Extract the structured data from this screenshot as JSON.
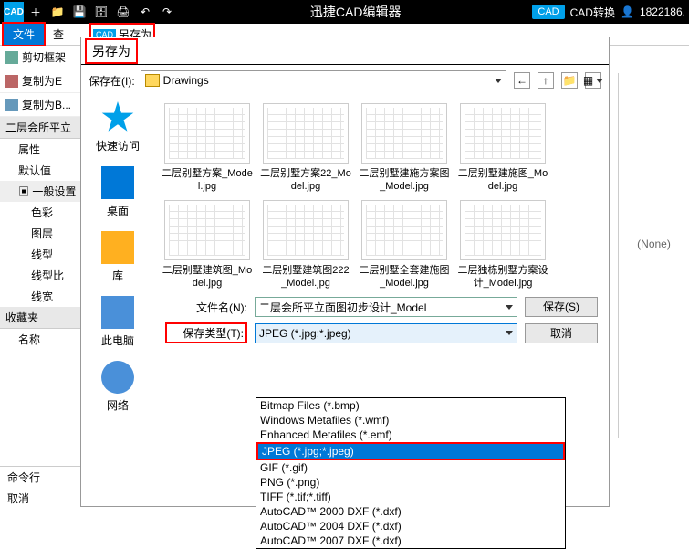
{
  "titlebar": {
    "title": "迅捷CAD编辑器",
    "cad_label": "CAD",
    "convert": "CAD转换",
    "user": "1822186."
  },
  "menubar": {
    "file": "文件",
    "view": "查",
    "saveas": "另存为",
    "saveas_ic": "CAD"
  },
  "left_actions": {
    "cut": "剪切框架",
    "copy_e": "复制为E",
    "copy_b": "复制为B..."
  },
  "tree": {
    "root": "二层会所平立",
    "attr": "属性",
    "default": "默认值",
    "general": "一般设置",
    "g_items": [
      "色彩",
      "图层",
      "线型",
      "线型比",
      "线宽"
    ],
    "favorites": "收藏夹",
    "name": "名称"
  },
  "cmd": {
    "cmdline": "命令行",
    "cancel": "取消"
  },
  "dialog": {
    "title": "另存为",
    "savein_label": "保存在(I):",
    "savein_value": "Drawings",
    "nav": {
      "quick": "快速访问",
      "desktop": "桌面",
      "lib": "库",
      "pc": "此电脑",
      "net": "网络"
    },
    "files": [
      "二层别墅方案_Model.jpg",
      "二层别墅方案22_Model.jpg",
      "二层别墅建施方案图_Model.jpg",
      "二层别墅建施图_Model.jpg",
      "二层别墅建筑图_Model.jpg",
      "二层别墅建筑图222_Model.jpg",
      "二层别墅全套建施图_Model.jpg",
      "二层独栋别墅方案设计_Model.jpg"
    ],
    "filename_label": "文件名(N):",
    "filename_value": "二层会所平立面图初步设计_Model",
    "filetype_label": "保存类型(T):",
    "filetype_value": "JPEG (*.jpg;*.jpeg)",
    "save_btn": "保存(S)",
    "cancel_btn": "取消",
    "type_options": [
      "Bitmap Files (*.bmp)",
      "Windows Metafiles (*.wmf)",
      "Enhanced Metafiles (*.emf)",
      "JPEG (*.jpg;*.jpeg)",
      "GIF (*.gif)",
      "PNG (*.png)",
      "TIFF (*.tif;*.tiff)",
      "AutoCAD™ 2000 DXF (*.dxf)",
      "AutoCAD™ 2004 DXF (*.dxf)",
      "AutoCAD™ 2007 DXF (*.dxf)"
    ]
  },
  "preview": {
    "none": "(None)"
  }
}
